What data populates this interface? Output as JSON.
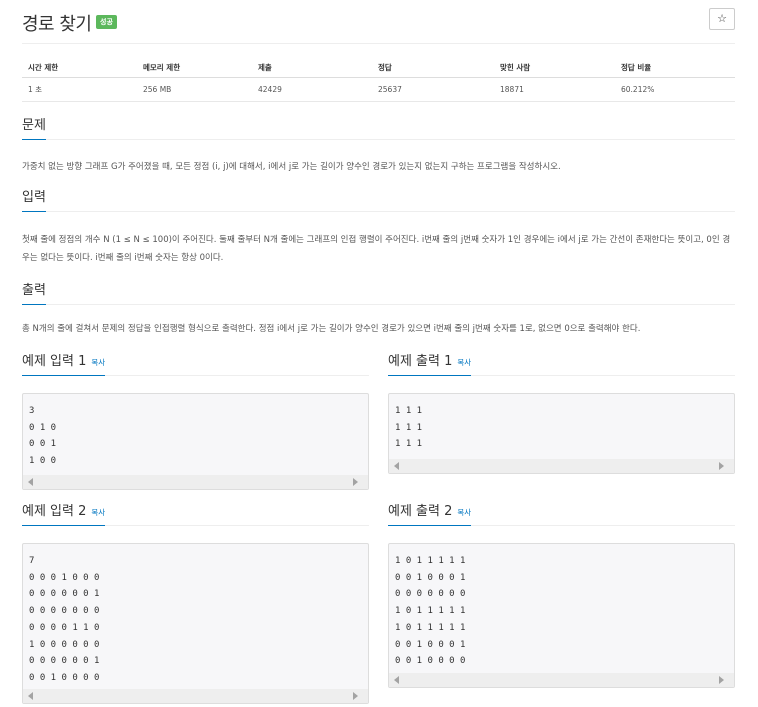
{
  "header": {
    "title": "경로 찾기",
    "badge": "성공",
    "star_icon": "☆"
  },
  "info_table": {
    "headers": [
      "시간 제한",
      "메모리 제한",
      "제출",
      "정답",
      "맞힌 사람",
      "정답 비율"
    ],
    "values": [
      "1 초",
      "256 MB",
      "42429",
      "25637",
      "18871",
      "60.212%"
    ]
  },
  "problem": {
    "heading": "문제",
    "text": "가중치 없는 방향 그래프 G가 주어졌을 때, 모든 정점 (i, j)에 대해서, i에서 j로 가는 길이가 양수인 경로가 있는지 없는지 구하는 프로그램을 작성하시오."
  },
  "input": {
    "heading": "입력",
    "text": "첫째 줄에 정점의 개수 N (1 ≤ N ≤ 100)이 주어진다. 둘째 줄부터 N개 줄에는 그래프의 인접 행렬이 주어진다. i번째 줄의 j번째 숫자가 1인 경우에는 i에서 j로 가는 간선이 존재한다는 뜻이고, 0인 경우는 없다는 뜻이다. i번째 줄의 i번째 숫자는 항상 0이다."
  },
  "output": {
    "heading": "출력",
    "text": "총 N개의 줄에 걸쳐서 문제의 정답을 인접행렬 형식으로 출력한다. 정점 i에서 j로 가는 길이가 양수인 경로가 있으면 i번째 줄의 j번째 숫자를 1로, 없으면 0으로 출력해야 한다."
  },
  "copy_label": "복사",
  "samples": {
    "in1": {
      "title": "예제 입력 1",
      "lines": [
        "3",
        "0 1 0",
        "0 0 1",
        "1 0 0"
      ]
    },
    "out1": {
      "title": "예제 출력 1",
      "lines": [
        "1 1 1",
        "1 1 1",
        "1 1 1"
      ]
    },
    "in2": {
      "title": "예제 입력 2",
      "lines": [
        "7",
        "0 0 0 1 0 0 0",
        "0 0 0 0 0 0 1",
        "0 0 0 0 0 0 0",
        "0 0 0 0 1 1 0",
        "1 0 0 0 0 0 0",
        "0 0 0 0 0 0 1",
        "0 0 1 0 0 0 0"
      ]
    },
    "out2": {
      "title": "예제 출력 2",
      "lines": [
        "1 0 1 1 1 1 1",
        "0 0 1 0 0 0 1",
        "0 0 0 0 0 0 0",
        "1 0 1 1 1 1 1",
        "1 0 1 1 1 1 1",
        "0 0 1 0 0 0 1",
        "0 0 1 0 0 0 0"
      ]
    }
  }
}
